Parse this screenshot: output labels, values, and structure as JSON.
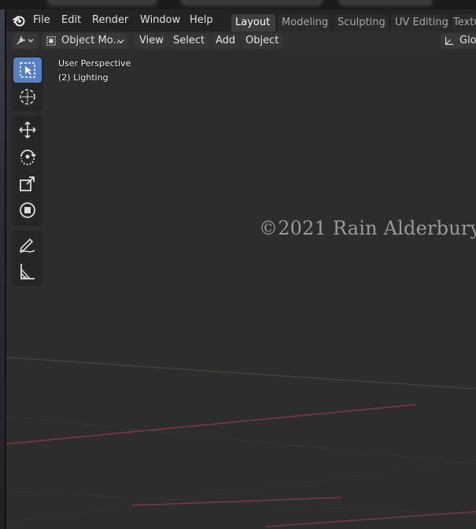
{
  "menubar": {
    "items": [
      "File",
      "Edit",
      "Render",
      "Window",
      "Help"
    ]
  },
  "workspaces": {
    "tabs": [
      "Layout",
      "Modeling",
      "Sculpting",
      "UV Editing",
      "Textu"
    ],
    "active": "Layout"
  },
  "header": {
    "mode_label": "Object Mo...",
    "menus": [
      "View",
      "Select",
      "Add",
      "Object"
    ],
    "transform_orientation": "Glo"
  },
  "viewport": {
    "perspective_label": "User Perspective",
    "collection_label": "(2) Lighting"
  },
  "toolbar": {
    "tools": [
      "select-box",
      "cursor",
      "move",
      "rotate",
      "scale",
      "transform",
      "annotate",
      "measure"
    ],
    "active_tool": "select-box"
  },
  "watermark": {
    "text": "©2021 Rain Alderbury"
  },
  "colors": {
    "active_tab_bg": "#3d3d3d",
    "active_tool_bg": "#5680c2",
    "grid_x_axis": "#8a3a48",
    "grid_y_axis": "#6b7a3a"
  }
}
